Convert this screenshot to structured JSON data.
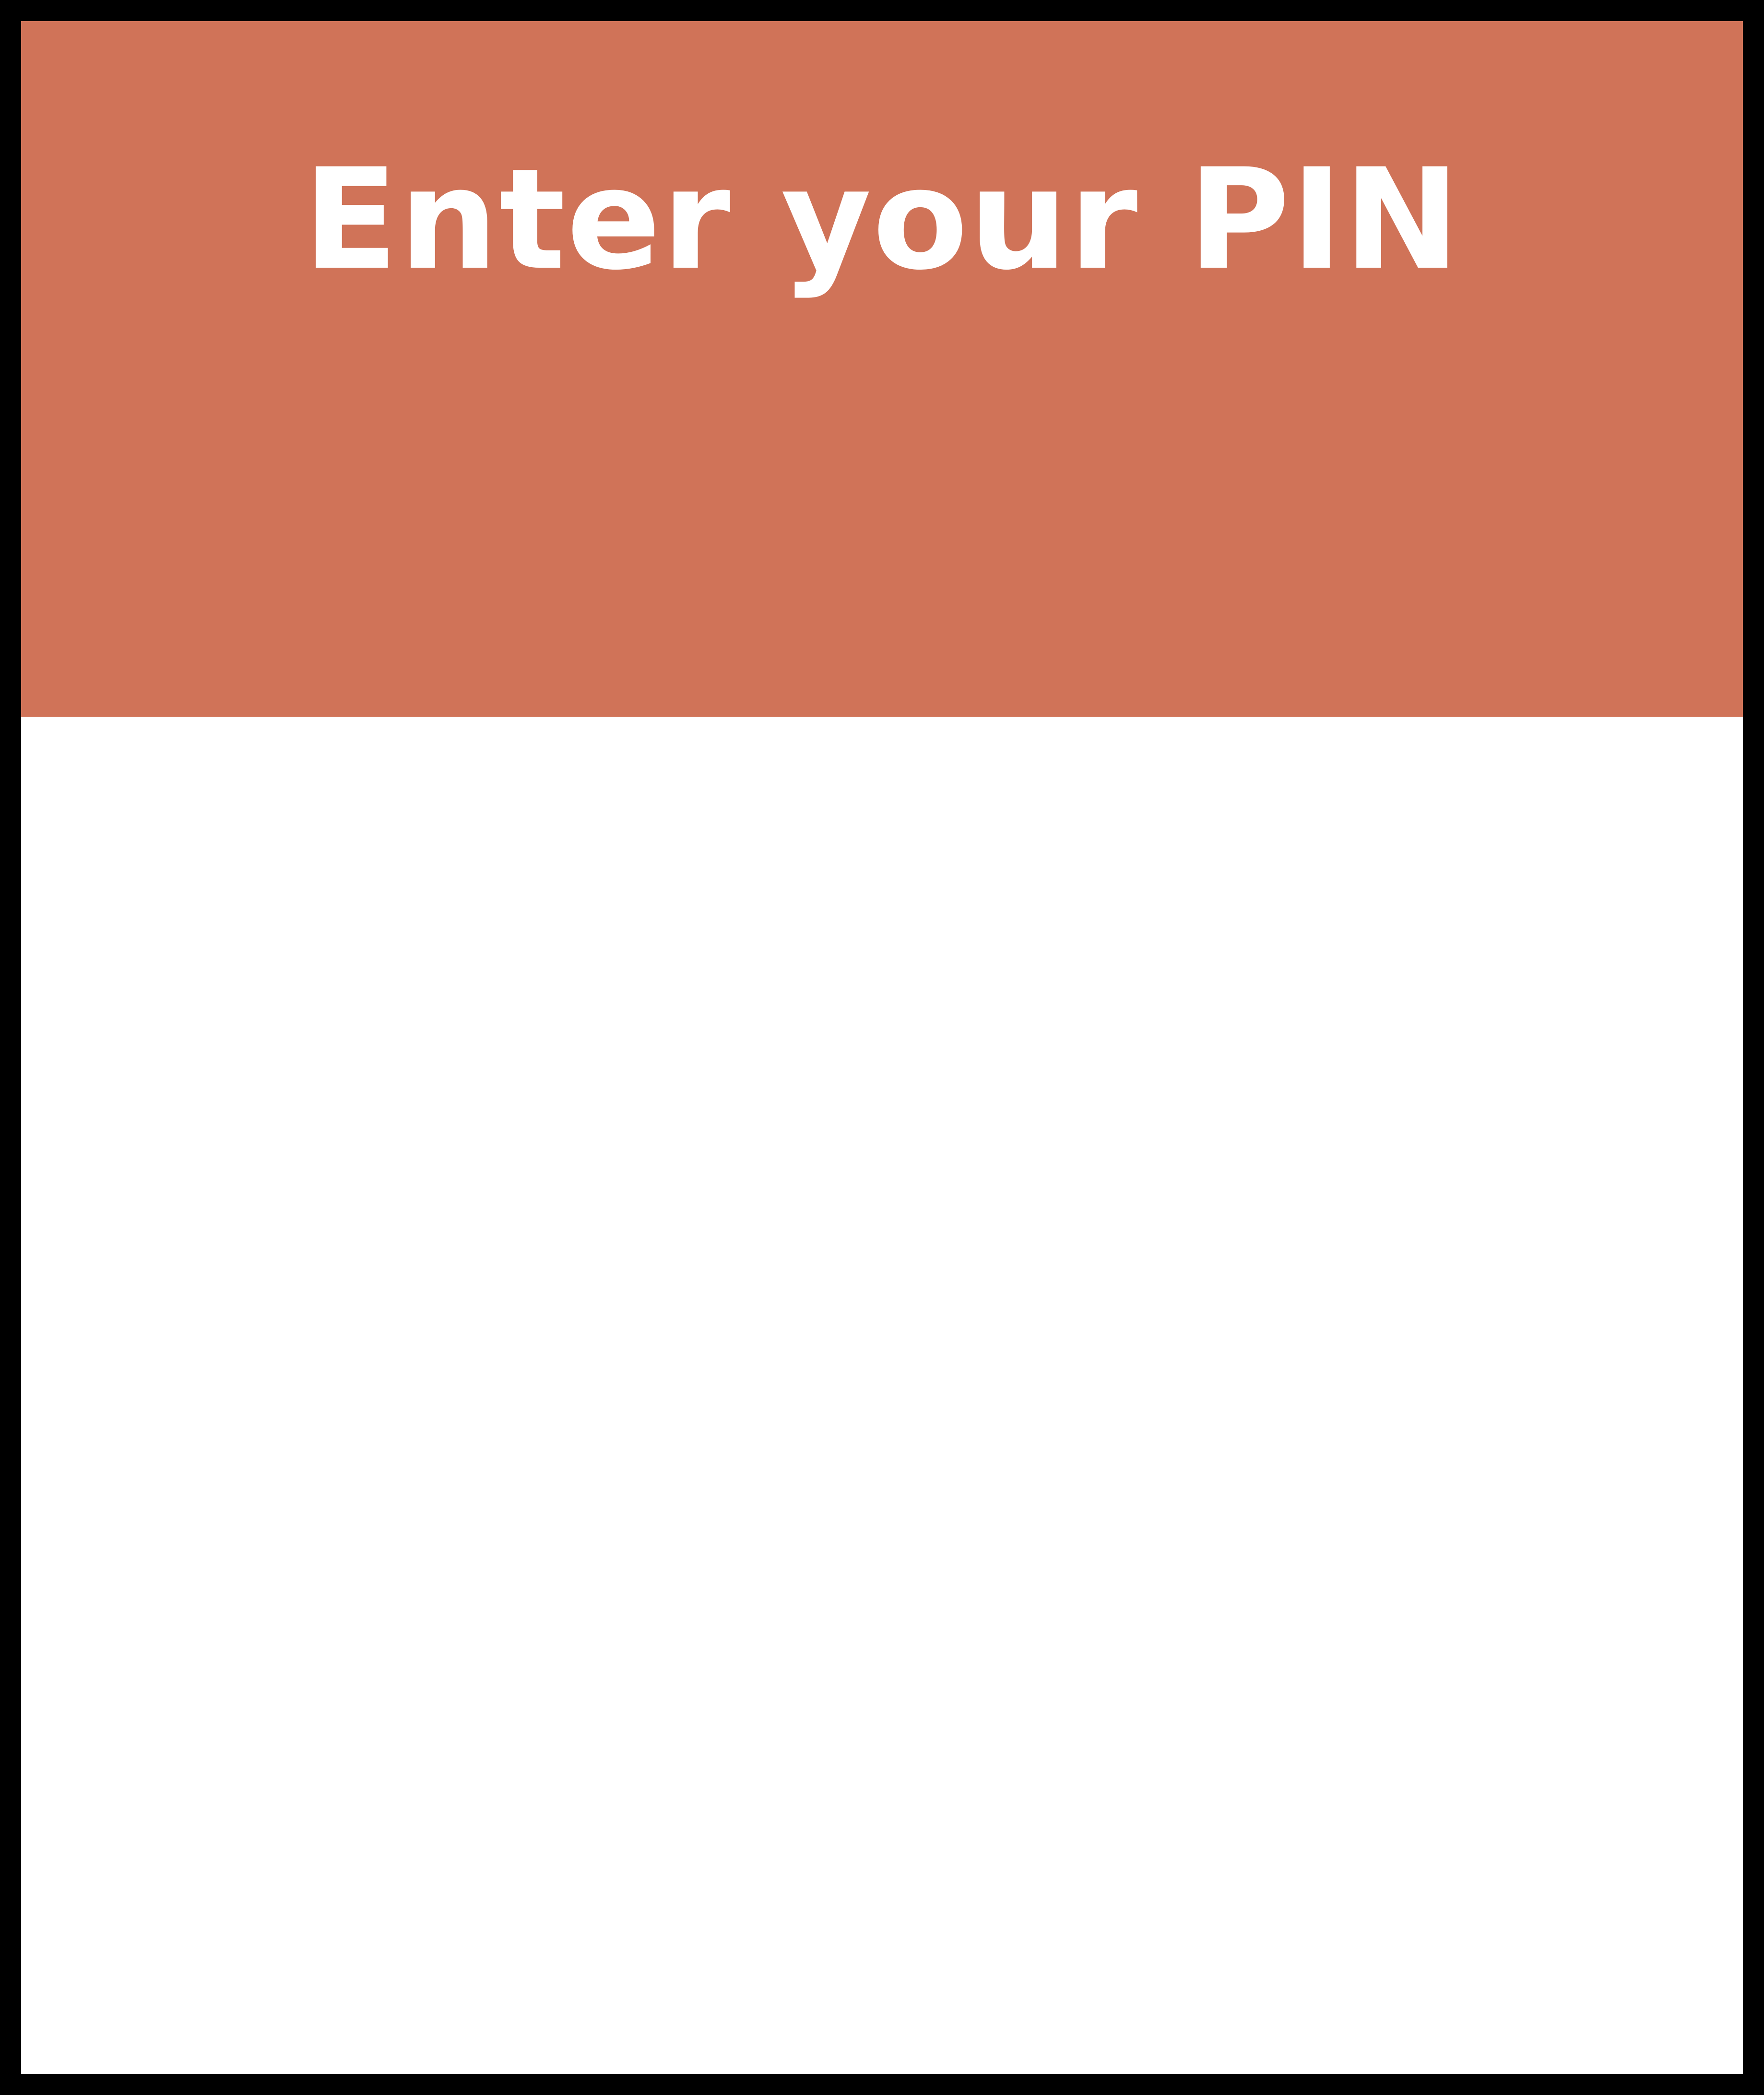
{
  "header": {
    "title": "Enter your PIN",
    "background_color": "#d07358",
    "text_color": "#ffffff"
  },
  "frame": {
    "border_color": "#000000",
    "content_background": "#ffffff"
  }
}
